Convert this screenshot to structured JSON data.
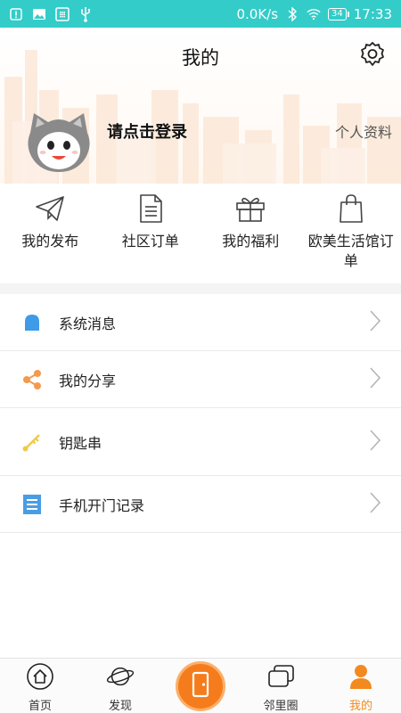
{
  "status_bar": {
    "speed": "0.0K/s",
    "battery": "34",
    "time": "17:33",
    "background": "#33ccc8"
  },
  "header": {
    "title": "我的",
    "login_prompt": "请点击登录",
    "profile_link": "个人资料"
  },
  "shortcuts": [
    {
      "label": "我的发布",
      "icon": "paper-plane-icon"
    },
    {
      "label": "社区订单",
      "icon": "document-icon"
    },
    {
      "label": "我的福利",
      "icon": "gift-icon"
    },
    {
      "label": "欧美生活馆订单",
      "icon": "shopping-bag-icon"
    }
  ],
  "menu": [
    {
      "label": "系统消息",
      "icon": "bell-icon",
      "color": "#3e9be8"
    },
    {
      "label": "我的分享",
      "icon": "share-icon",
      "color": "#f39a4e"
    },
    {
      "label": "钥匙串",
      "icon": "key-icon",
      "color": "#f0c94a"
    },
    {
      "label": "手机开门记录",
      "icon": "list-icon",
      "color": "#4a9de5"
    }
  ],
  "bottom_nav": [
    {
      "label": "首页",
      "icon": "home-icon",
      "active": false
    },
    {
      "label": "发现",
      "icon": "planet-icon",
      "active": false
    },
    {
      "label": "",
      "icon": "door-icon",
      "active": false
    },
    {
      "label": "邻里圈",
      "icon": "cards-icon",
      "active": false
    },
    {
      "label": "我的",
      "icon": "person-icon",
      "active": true
    }
  ],
  "colors": {
    "accent": "#f28a1f",
    "teal": "#33ccc8"
  }
}
